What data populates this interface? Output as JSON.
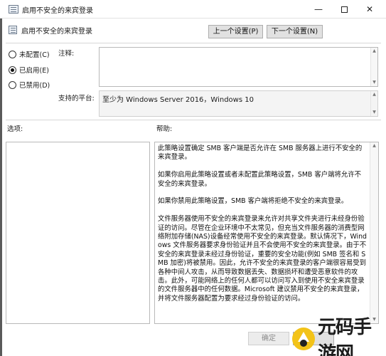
{
  "window": {
    "title": "启用不安全的来宾登录",
    "controls": {
      "minimize": "—",
      "close": "✕"
    }
  },
  "header": {
    "policy_title": "启用不安全的来宾登录",
    "prev_label": "上一个设置(P)",
    "next_label": "下一个设置(N)"
  },
  "radios": [
    {
      "label": "未配置(C)",
      "selected": false
    },
    {
      "label": "已启用(E)",
      "selected": true
    },
    {
      "label": "已禁用(D)",
      "selected": false
    }
  ],
  "labels": {
    "comment": "注释:",
    "platform": "支持的平台:",
    "options": "选项:",
    "help": "帮助:"
  },
  "platform_value": "至少为 Windows Server 2016，Windows 10",
  "help_paragraphs": [
    "此策略设置确定 SMB 客户端是否允许在 SMB 服务器上进行不安全的来宾登录。",
    "如果你启用此策略设置或者未配置此策略设置，SMB 客户端将允许不安全的来宾登录。",
    "如果你禁用此策略设置，SMB 客户端将拒绝不安全的来宾登录。",
    "文件服务器使用不安全的来宾登录来允许对共享文件夹进行未经身份验证的访问。尽管在企业环境中不太常见，但充当文件服务器的消费型网络附加存储(NAS)设备经常使用不安全的来宾登录。默认情况下，Windows 文件服务器要求身份验证并且不会使用不安全的来宾登录。由于不安全的来宾登录未经过身份验证，重要的安全功能(例如 SMB 签名和 SMB 加密)将被禁用。因此，允许不安全的来宾登录的客户端很容易受到各种中间人攻击，从而导致数据丢失、数据损坏和遭受恶意软件的攻击。此外，可能网络上的任何人都可以访问写入到使用不安全来宾登录的文件服务器中的任何数据。Microsoft 建议禁用不安全的来宾登录，并将文件服务器配置为要求经过身份验证的访问。"
  ],
  "footer": {
    "ok_label": "确定",
    "cancel_label": ""
  },
  "watermark": {
    "text": "元码手游网"
  }
}
